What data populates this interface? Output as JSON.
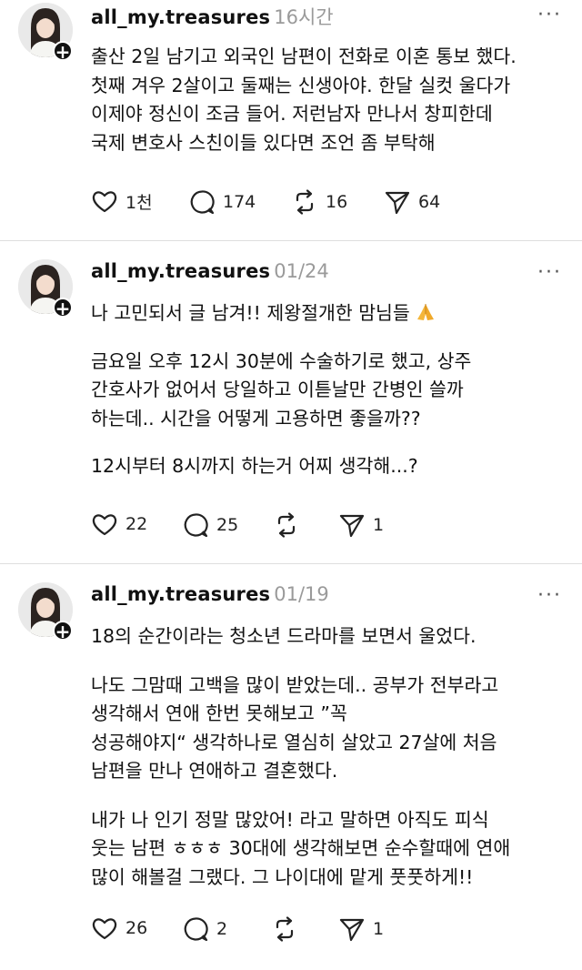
{
  "posts": [
    {
      "username": "all_my.treasures",
      "time": "16시간",
      "more": "···",
      "paragraphs": [
        "출산 2일 남기고 외국인 남편이 전화로 이혼 통보 했다.\n첫째 겨우 2살이고 둘째는 신생아야. 한달 실컷 울다가\n이제야 정신이 조금 들어. 저런남자 만나서 창피한데\n국제 변호사 스친이들 있다면 조언 좀 부탁해"
      ],
      "likes": "1천",
      "comments": "174",
      "reposts": "16",
      "shares": "64"
    },
    {
      "username": "all_my.treasures",
      "time": "01/24",
      "more": "···",
      "paragraphs": [
        "나 고민되서 글 남겨!! 제왕절개한 맘님들",
        "금요일 오후 12시 30분에 수술하기로 했고, 상주\n간호사가 없어서 당일하고 이튿날만 간병인 쓸까\n하는데.. 시간을 어떻게 고용하면 좋을까??",
        "12시부터 8시까지 하는거 어찌 생각해...?"
      ],
      "likes": "22",
      "comments": "25",
      "reposts": "",
      "shares": "1"
    },
    {
      "username": "all_my.treasures",
      "time": "01/19",
      "more": "···",
      "paragraphs": [
        "18의 순간이라는 청소년 드라마를 보면서 울었다.",
        "나도 그맘때 고백을 많이 받았는데.. 공부가 전부라고\n생각해서 연애 한번 못해보고 ”꼭\n성공해야지“ 생각하나로 열심히 살았고 27살에 처음\n남편을 만나 연애하고 결혼했다.",
        "내가 나 인기 정말 많았어! 라고 말하면 아직도 피식\n웃는 남편 ㅎㅎㅎ 30대에 생각해보면 순수할때에 연애\n많이 해볼걸 그랬다. 그 나이대에 맡게 풋풋하게!!"
      ],
      "likes": "26",
      "comments": "2",
      "reposts": "",
      "shares": "1"
    }
  ],
  "icons": {
    "like": "heart-icon",
    "comment": "comment-bubble-icon",
    "repost": "repost-icon",
    "share": "send-icon",
    "pray": "folded-hands-icon",
    "follow": "plus-icon"
  },
  "colors": {
    "text": "#111111",
    "meta": "#9a9a9a",
    "divider": "#dedede"
  }
}
